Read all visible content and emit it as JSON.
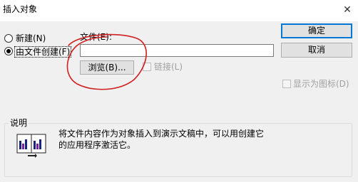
{
  "window": {
    "title": "插入对象",
    "close_glyph": "✕"
  },
  "options": {
    "new_label": "新建(N)",
    "from_file_label": "由文件创建(F)",
    "selected": "from_file"
  },
  "file": {
    "label": "文件(E):",
    "value": ""
  },
  "buttons": {
    "ok": "确定",
    "cancel": "取消",
    "browse": "浏览(B)..."
  },
  "checkboxes": {
    "link": {
      "label": "链接(L)",
      "checked": false,
      "enabled": false
    },
    "display_as_icon": {
      "label": "显示为图标(D)",
      "checked": false,
      "enabled": false
    }
  },
  "result": {
    "legend": "说明",
    "text_line1": "将文件内容作为对象插入到演示文稿中，可以用创建它",
    "text_line2": "的应用程序激活它。"
  },
  "annotation": {
    "color": "#d02020"
  }
}
